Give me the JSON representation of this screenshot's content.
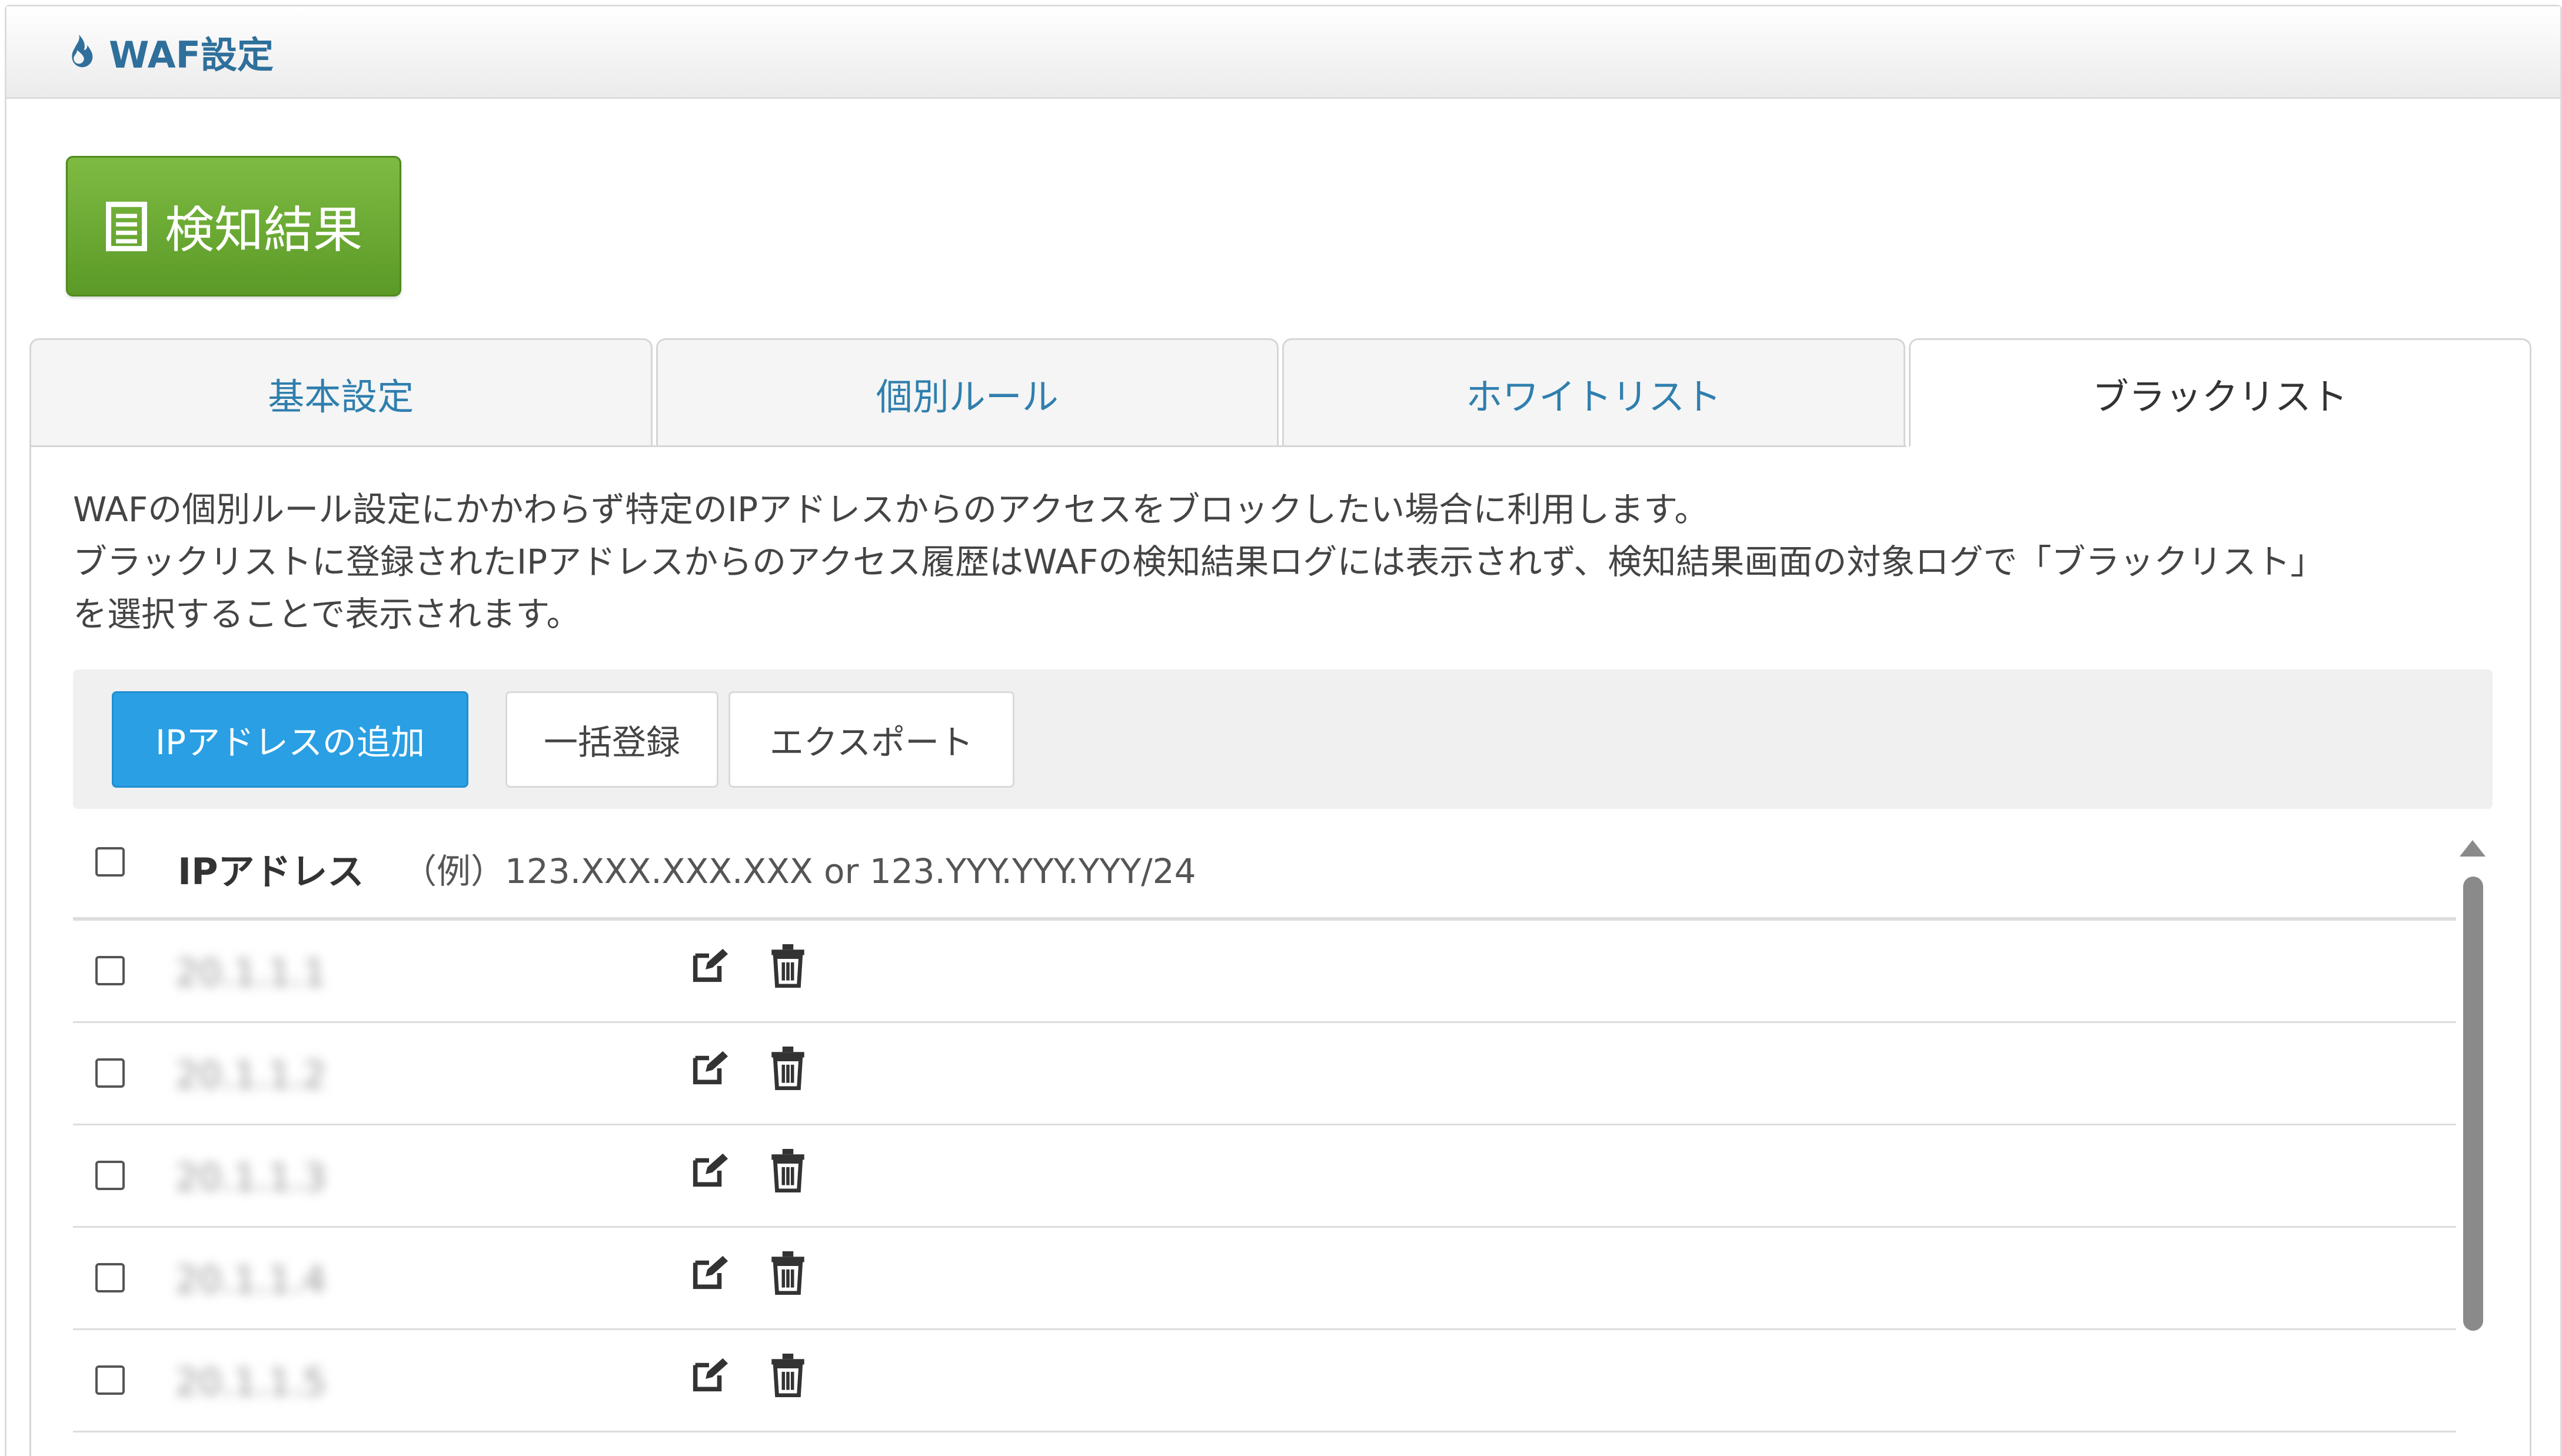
{
  "header": {
    "title": "WAF設定",
    "icon": "flame-icon"
  },
  "detection_button": {
    "label": "検知結果",
    "icon": "document-list-icon"
  },
  "tabs": [
    {
      "label": "基本設定",
      "active": false
    },
    {
      "label": "個別ルール",
      "active": false
    },
    {
      "label": "ホワイトリスト",
      "active": false
    },
    {
      "label": "ブラックリスト",
      "active": true
    }
  ],
  "description": {
    "line1": "WAFの個別ルール設定にかかわらず特定のIPアドレスからのアクセスをブロックしたい場合に利用します。",
    "line2": "ブラックリストに登録されたIPアドレスからのアクセス履歴はWAFの検知結果ログには表示されず、検知結果画面の対象ログで「ブラックリスト」",
    "line3": "を選択することで表示されます。"
  },
  "toolbar": {
    "add_label": "IPアドレスの追加",
    "bulk_label": "一括登録",
    "export_label": "エクスポート"
  },
  "list": {
    "header_label": "IPアドレス",
    "header_hint": "（例）123.XXX.XXX.XXX or 123.YYY.YYY.YYY/24",
    "rows": [
      {
        "ip": "20.1.1.1"
      },
      {
        "ip": "20.1.1.2"
      },
      {
        "ip": "20.1.1.3"
      },
      {
        "ip": "20.1.1.4"
      },
      {
        "ip": "20.1.1.5"
      }
    ]
  },
  "colors": {
    "accent_blue": "#2a9fe3",
    "success_green": "#6aab33",
    "link_blue": "#2f7fae"
  }
}
